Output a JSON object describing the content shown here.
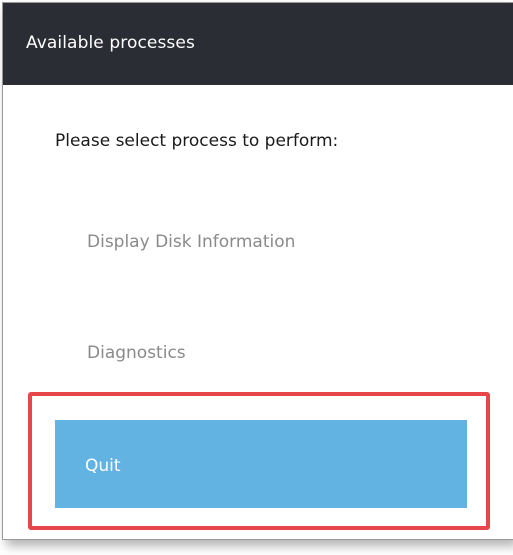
{
  "window": {
    "title": "Available processes"
  },
  "main": {
    "prompt": "Please select process to perform:",
    "options": [
      {
        "label": "Display Disk Information",
        "selected": false
      },
      {
        "label": "Diagnostics",
        "selected": false
      },
      {
        "label": "Quit",
        "selected": true
      }
    ]
  },
  "colors": {
    "titlebar": "#2a2d34",
    "selected_option": "#62b3e1",
    "highlight_border": "#e8474a",
    "option_text": "#8a8a8a"
  }
}
